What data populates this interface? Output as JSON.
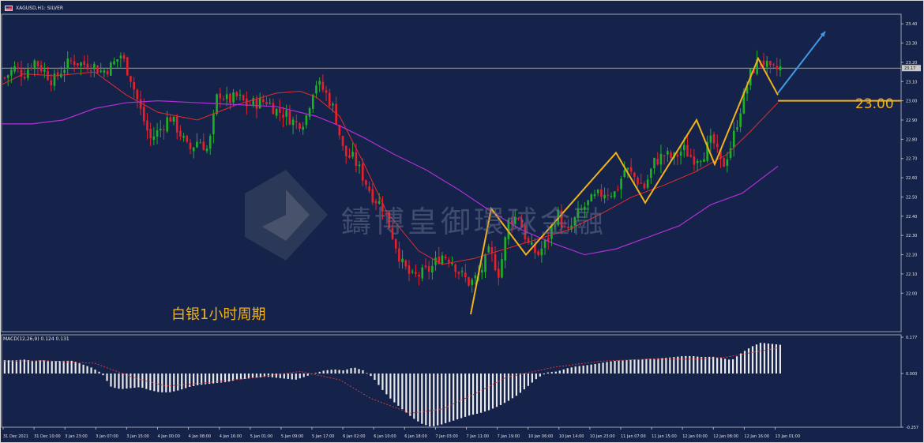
{
  "header": {
    "symbol": "XAGUSD,H1: SILVER",
    "flag_icon": "us-flag-icon"
  },
  "annotation": {
    "label": "白银1小时周期",
    "level_label": "23.00",
    "color": "#f2b21c"
  },
  "watermark": {
    "text": "鑄博皇御環球金融",
    "logo": "diamond-logo-icon"
  },
  "macd": {
    "label": "MACD(12,26,9) 0.124 0.131"
  },
  "colors": {
    "background": "#15234a",
    "up": "#1fb125",
    "down": "#e8202a",
    "ma_short": "#e52b2b",
    "ma_long": "#b02fd6",
    "macd_hist": "#e8e8e8",
    "signal": "#d63838",
    "zigzag": "#f2b21c",
    "projection": "#3f9ae8"
  },
  "chart_data": [
    {
      "type": "candlestick",
      "symbol": "XAGUSD",
      "timeframe": "H1",
      "ylim": [
        21.8,
        23.45
      ],
      "y_ticks": [
        "23.40",
        "23.30",
        "23.20",
        "23.10",
        "23.00",
        "22.90",
        "22.80",
        "22.70",
        "22.60",
        "22.50",
        "22.40",
        "22.30",
        "22.20",
        "22.10",
        "22.00"
      ],
      "current_price": "23.17",
      "x_labels": [
        "31 Dec 2021",
        "31 Dec 10:00",
        "3 Jan 23:00",
        "3 Jan 07:00",
        "3 Jan 15:00",
        "4 Jan 00:00",
        "4 Jan 08:00",
        "4 Jan 16:00",
        "5 Jan 01:00",
        "5 Jan 09:00",
        "5 Jan 17:00",
        "6 Jan 02:00",
        "6 Jan 10:00",
        "6 Jan 18:00",
        "7 Jan 03:00",
        "7 Jan 11:00",
        "7 Jan 19:00",
        "10 Jan 06:00",
        "10 Jan 14:00",
        "10 Jan 23:00",
        "11 Jan 07:00",
        "11 Jan 15:00",
        "12 Jan 00:00",
        "12 Jan 08:00",
        "12 Jan 16:00",
        "13 Jan 01:00"
      ],
      "close_anchors": [
        23.12,
        23.17,
        23.14,
        23.21,
        23.16,
        23.1,
        23.17,
        23.21,
        23.19,
        23.19,
        23.15,
        23.18,
        23.24,
        23.12,
        22.95,
        22.8,
        22.85,
        22.92,
        22.84,
        22.74,
        22.8,
        22.74,
        23.05,
        23.0,
        23.02,
        22.98,
        22.99,
        23.0,
        22.95,
        22.93,
        22.88,
        22.9,
        23.1,
        23.05,
        22.95,
        22.72,
        22.7,
        22.6,
        22.5,
        22.45,
        22.3,
        22.15,
        22.08,
        22.1,
        22.13,
        22.2,
        22.18,
        22.1,
        22.05,
        22.1,
        22.22,
        22.1,
        22.38,
        22.4,
        22.25,
        22.2,
        22.28,
        22.42,
        22.3,
        22.4,
        22.46,
        22.5,
        22.53,
        22.52,
        22.65,
        22.6,
        22.55,
        22.68,
        22.72,
        22.7,
        22.75,
        22.7,
        22.72,
        22.8,
        22.65,
        22.78,
        22.98,
        23.15,
        23.22,
        23.15,
        23.17
      ],
      "ma_short": [
        [
          0,
          23.08
        ],
        [
          30,
          23.14
        ],
        [
          70,
          23.13
        ],
        [
          120,
          23.15
        ],
        [
          160,
          23.03
        ],
        [
          200,
          22.94
        ],
        [
          250,
          22.9
        ],
        [
          300,
          22.98
        ],
        [
          350,
          23.04
        ],
        [
          380,
          23.05
        ],
        [
          400,
          23.02
        ],
        [
          430,
          22.92
        ],
        [
          460,
          22.68
        ],
        [
          490,
          22.42
        ],
        [
          530,
          22.22
        ],
        [
          560,
          22.15
        ],
        [
          600,
          22.18
        ],
        [
          640,
          22.23
        ],
        [
          680,
          22.28
        ],
        [
          720,
          22.33
        ],
        [
          760,
          22.41
        ],
        [
          800,
          22.5
        ],
        [
          840,
          22.56
        ],
        [
          880,
          22.63
        ],
        [
          920,
          22.72
        ],
        [
          950,
          22.84
        ],
        [
          985,
          22.99
        ]
      ],
      "ma_long": [
        [
          0,
          22.88
        ],
        [
          40,
          22.88
        ],
        [
          80,
          22.9
        ],
        [
          120,
          22.96
        ],
        [
          160,
          22.99
        ],
        [
          200,
          23.0
        ],
        [
          250,
          22.99
        ],
        [
          300,
          22.98
        ],
        [
          350,
          22.97
        ],
        [
          400,
          22.92
        ],
        [
          430,
          22.87
        ],
        [
          460,
          22.81
        ],
        [
          500,
          22.72
        ],
        [
          540,
          22.64
        ],
        [
          580,
          22.54
        ],
        [
          620,
          22.43
        ],
        [
          660,
          22.33
        ],
        [
          700,
          22.26
        ],
        [
          740,
          22.2
        ],
        [
          780,
          22.23
        ],
        [
          820,
          22.29
        ],
        [
          860,
          22.35
        ],
        [
          900,
          22.46
        ],
        [
          940,
          22.52
        ],
        [
          985,
          22.66
        ]
      ],
      "zigzag": [
        [
          596,
          21.89
        ],
        [
          622,
          22.44
        ],
        [
          666,
          22.2
        ],
        [
          780,
          22.73
        ],
        [
          817,
          22.47
        ],
        [
          882,
          22.9
        ],
        [
          905,
          22.67
        ],
        [
          960,
          23.22
        ],
        [
          985,
          23.03
        ]
      ],
      "projection": [
        [
          985,
          23.04
        ],
        [
          1045,
          23.36
        ]
      ],
      "level": 23.0
    },
    {
      "type": "bar",
      "name": "MACD",
      "ylim": [
        -0.257,
        0.177
      ],
      "y_ticks": [
        "0.177",
        "0.000",
        "-0.257"
      ],
      "hist_anchors": [
        0.065,
        0.064,
        0.068,
        0.062,
        0.065,
        0.06,
        0.062,
        0.062,
        0.045,
        0.028,
        0.002,
        -0.065,
        -0.075,
        -0.07,
        -0.065,
        -0.08,
        -0.09,
        -0.09,
        -0.08,
        -0.065,
        -0.055,
        -0.05,
        -0.045,
        -0.04,
        -0.03,
        -0.025,
        -0.02,
        -0.015,
        -0.02,
        -0.025,
        -0.03,
        -0.015,
        0.002,
        0.015,
        0.02,
        0.015,
        0.03,
        0.015,
        -0.02,
        -0.08,
        -0.13,
        -0.17,
        -0.21,
        -0.24,
        -0.255,
        -0.245,
        -0.23,
        -0.215,
        -0.2,
        -0.19,
        -0.175,
        -0.155,
        -0.13,
        -0.1,
        -0.06,
        -0.02,
        0.005,
        0.01,
        0.025,
        0.035,
        0.04,
        0.047,
        0.055,
        0.062,
        0.065,
        0.068,
        0.07,
        0.073,
        0.075,
        0.08,
        0.085,
        0.085,
        0.08,
        0.082,
        0.075,
        0.065,
        0.1,
        0.13,
        0.15,
        0.145,
        0.14
      ],
      "signal": [
        [
          0,
          0.06
        ],
        [
          60,
          0.062
        ],
        [
          120,
          0.05
        ],
        [
          170,
          -0.02
        ],
        [
          210,
          -0.06
        ],
        [
          260,
          -0.045
        ],
        [
          320,
          -0.02
        ],
        [
          380,
          0.01
        ],
        [
          430,
          -0.03
        ],
        [
          470,
          -0.12
        ],
        [
          520,
          -0.19
        ],
        [
          560,
          -0.17
        ],
        [
          600,
          -0.1
        ],
        [
          640,
          -0.02
        ],
        [
          700,
          0.03
        ],
        [
          760,
          0.06
        ],
        [
          820,
          0.07
        ],
        [
          880,
          0.07
        ],
        [
          920,
          0.08
        ],
        [
          985,
          0.125
        ]
      ]
    }
  ]
}
